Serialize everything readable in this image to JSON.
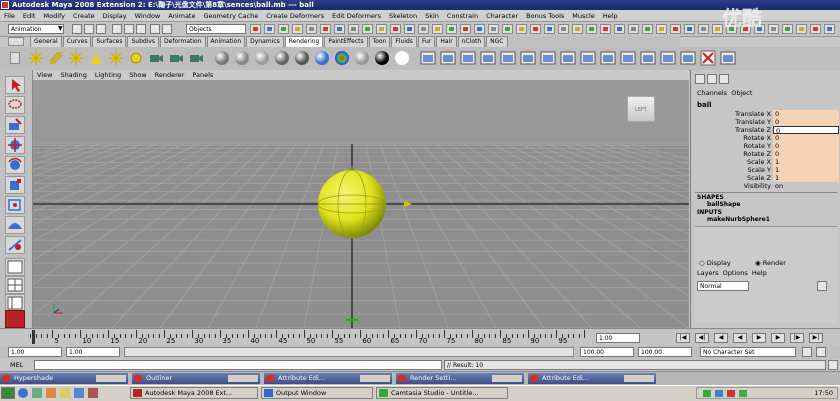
{
  "window": {
    "title": "Autodesk Maya 2008 Extension 2: E:\\鞠子\\光盘文件\\第8章\\sences\\ball.mb   ---   ball"
  },
  "watermark": "优酷",
  "menu": [
    "File",
    "Edit",
    "Modify",
    "Create",
    "Display",
    "Window",
    "Animate",
    "Geometry Cache",
    "Create Deformers",
    "Edit Deformers",
    "Skeleton",
    "Skin",
    "Constrain",
    "Character",
    "Bonus Tools",
    "Muscle",
    "Help"
  ],
  "status_line": {
    "mode": "Animation",
    "selection_mask": "Objects"
  },
  "shelf_tabs": [
    "General",
    "Curves",
    "Surfaces",
    "Subdivs",
    "Deformation",
    "Animation",
    "Dynamics",
    "Rendering",
    "PaintEffects",
    "Toon",
    "Fluids",
    "Fur",
    "Hair",
    "nCloth",
    "NGC"
  ],
  "shelf_active": "Rendering",
  "panel_menu": [
    "View",
    "Shading",
    "Lighting",
    "Show",
    "Renderer",
    "Panels"
  ],
  "view_cube_label": "LEFT",
  "channel_box": {
    "menu": [
      "Channels",
      "Object"
    ],
    "object": "ball",
    "attributes": [
      {
        "name": "Translate X",
        "value": "0"
      },
      {
        "name": "Translate Y",
        "value": "0"
      },
      {
        "name": "Translate Z",
        "value": "0"
      },
      {
        "name": "Rotate X",
        "value": "0"
      },
      {
        "name": "Rotate Y",
        "value": "0"
      },
      {
        "name": "Rotate Z",
        "value": "0"
      },
      {
        "name": "Scale X",
        "value": "1"
      },
      {
        "name": "Scale Y",
        "value": "1"
      },
      {
        "name": "Scale Z",
        "value": "1"
      },
      {
        "name": "Visibility",
        "value": "on"
      }
    ],
    "shapes_header": "SHAPES",
    "shape": "ballShape",
    "inputs_header": "INPUTS",
    "input": "makeNurbSphere1"
  },
  "layer_editor": {
    "display": "Display",
    "render": "Render",
    "menu": [
      "Layers",
      "Options",
      "Help"
    ],
    "blend": "Normal"
  },
  "timeline": {
    "ticks": [
      "5",
      "10",
      "15",
      "20",
      "25",
      "30",
      "35",
      "40",
      "45",
      "50",
      "55",
      "60",
      "65",
      "70",
      "75",
      "80",
      "85",
      "90",
      "95"
    ],
    "current_frame": "1.00"
  },
  "range": {
    "start": "1.00",
    "playback_start": "1.00",
    "playback_end": "100.00",
    "end": "100.00",
    "character": "No Character Set"
  },
  "command_line": {
    "label": "MEL",
    "result": "// Result: 10"
  },
  "minimized_windows": [
    "Hypershade",
    "Outliner",
    "Attribute Edi...",
    "Render Setti...",
    "Attribute Edi..."
  ],
  "taskbar": {
    "items": [
      "Autodesk Maya 2008 Ext...",
      "Output Window",
      "Camtasia Studio - Untitle..."
    ],
    "clock": "17:50"
  },
  "colors": {
    "title_bg": "#1a2a6a",
    "viewport_bg": "#959595",
    "ball": "#e2e21a",
    "attr_bg": "#f4d3b6"
  }
}
